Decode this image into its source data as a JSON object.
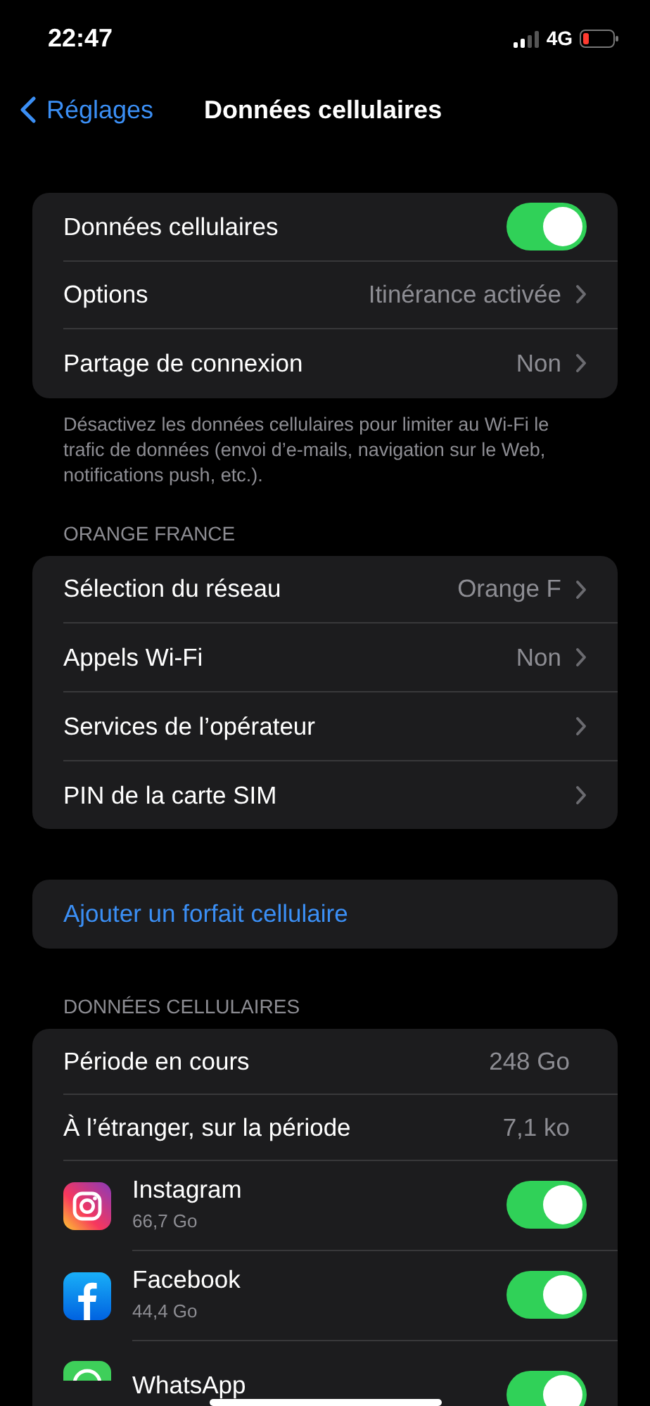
{
  "status_bar": {
    "time": "22:47",
    "network": "4G"
  },
  "nav": {
    "back": "Réglages",
    "title": "Données cellulaires"
  },
  "sections": [
    {
      "rows": [
        {
          "kind": "toggle",
          "label": "Données cellulaires",
          "on": true
        },
        {
          "kind": "detail",
          "label": "Options",
          "value": "Itinérance activée"
        },
        {
          "kind": "detail",
          "label": "Partage de connexion",
          "value": "Non"
        }
      ],
      "footer": "Désactivez les données cellulaires pour limiter au Wi-Fi le trafic de données (envoi d’e-mails, navigation sur le Web, notifications push, etc.)."
    },
    {
      "header": "ORANGE FRANCE",
      "rows": [
        {
          "kind": "detail",
          "label": "Sélection du réseau",
          "value": "Orange F"
        },
        {
          "kind": "detail",
          "label": "Appels Wi-Fi",
          "value": "Non"
        },
        {
          "kind": "detail",
          "label": "Services de l’opérateur"
        },
        {
          "kind": "detail",
          "label": "PIN de la carte SIM"
        }
      ]
    },
    {
      "rows": [
        {
          "kind": "link",
          "label": "Ajouter un forfait cellulaire"
        }
      ]
    },
    {
      "header": "DONNÉES CELLULAIRES",
      "rows": [
        {
          "kind": "stat",
          "label": "Période en cours",
          "value": "248 Go"
        },
        {
          "kind": "stat",
          "label": "À l’étranger, sur la période",
          "value": "7,1 ko"
        },
        {
          "kind": "app",
          "label": "Instagram",
          "subtitle": "66,7 Go",
          "on": true
        },
        {
          "kind": "app",
          "label": "Facebook",
          "subtitle": "44,4 Go",
          "on": true
        },
        {
          "kind": "app",
          "label": "WhatsApp",
          "on": true
        }
      ]
    }
  ]
}
